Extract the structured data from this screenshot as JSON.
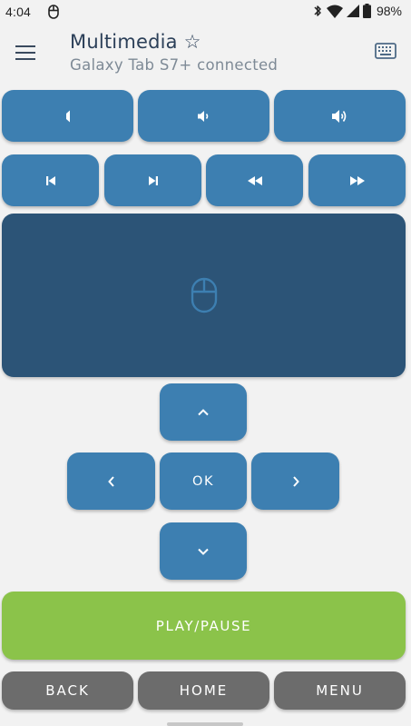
{
  "status_bar": {
    "time": "4:04",
    "battery": "98%",
    "icons": [
      "mouse-icon",
      "bluetooth-icon",
      "wifi-icon",
      "cell-signal-icon",
      "battery-icon"
    ]
  },
  "header": {
    "title": "Multimedia ☆",
    "subtitle": "Galaxy Tab S7+ connected",
    "menu_icon": "hamburger-menu-icon",
    "keyboard_icon": "keyboard-icon"
  },
  "volume_row": [
    {
      "name": "volume-mute",
      "icon": "speaker-off-icon"
    },
    {
      "name": "volume-down",
      "icon": "speaker-low-icon"
    },
    {
      "name": "volume-up",
      "icon": "speaker-high-icon"
    }
  ],
  "media_row": [
    {
      "name": "previous-track",
      "icon": "skip-previous-icon"
    },
    {
      "name": "next-track",
      "icon": "skip-next-icon"
    },
    {
      "name": "rewind",
      "icon": "rewind-icon"
    },
    {
      "name": "fast-forward",
      "icon": "fast-forward-icon"
    }
  ],
  "touchpad": {
    "icon": "mouse-icon"
  },
  "dpad": {
    "up_icon": "chevron-up-icon",
    "left_icon": "chevron-left-icon",
    "ok_label": "OK",
    "right_icon": "chevron-right-icon",
    "down_icon": "chevron-down-icon"
  },
  "play_pause": {
    "label": "PLAY/PAUSE"
  },
  "bottom_buttons": {
    "back_label": "BACK",
    "home_label": "HOME",
    "menu_label": "MENU"
  },
  "colors": {
    "background": "#f2f2f2",
    "button_blue": "#3d7fb1",
    "touchpad_navy": "#2c5477",
    "play_green": "#8bc34a",
    "gray_button": "#6c6c6c",
    "title_text": "#2b3f58",
    "subtitle_text": "#7e8a96"
  }
}
